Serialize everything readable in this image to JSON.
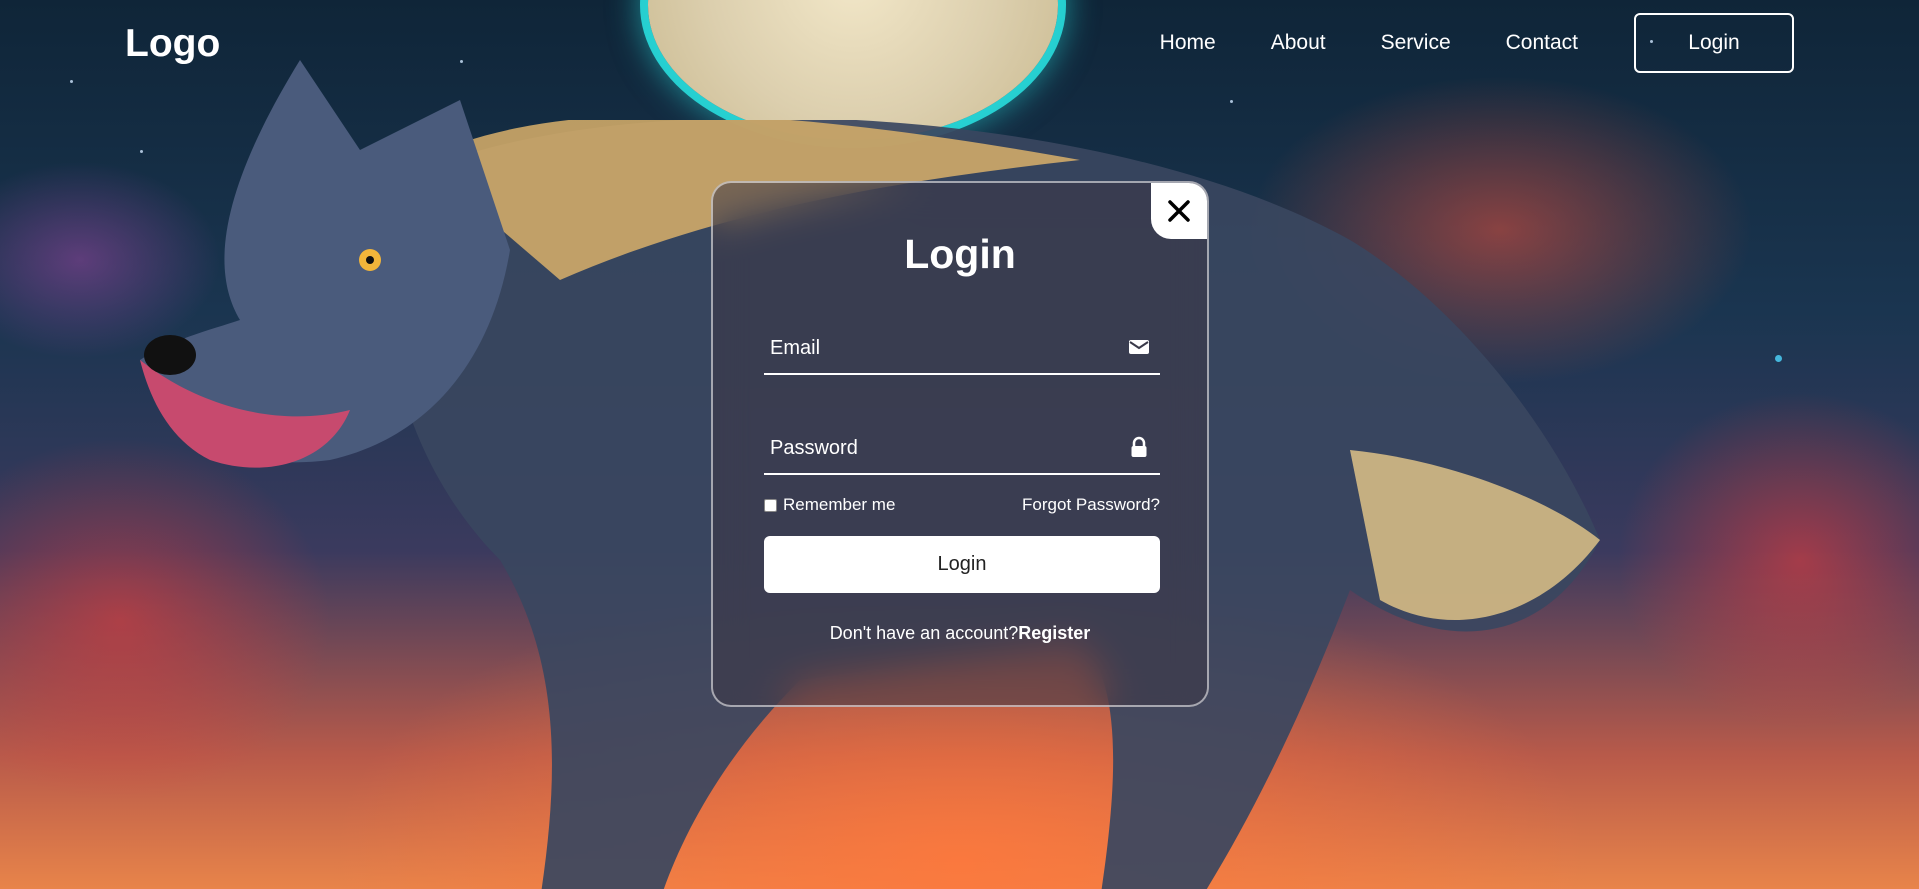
{
  "navbar": {
    "logo": "Logo",
    "links": [
      "Home",
      "About",
      "Service",
      "Contact"
    ],
    "login_button": "Login"
  },
  "modal": {
    "title": "Login",
    "email_placeholder": "Email",
    "email_icon": "mail-icon",
    "password_placeholder": "Password",
    "password_icon": "lock-icon",
    "remember_label": "Remember me",
    "forgot_label": "Forgot Password?",
    "submit_label": "Login",
    "register_prompt": "Don't have an account?",
    "register_link": "Register",
    "close_icon": "close-icon"
  },
  "colors": {
    "primary_text": "#ffffff",
    "button_bg": "#ffffff",
    "button_text": "#222222"
  }
}
